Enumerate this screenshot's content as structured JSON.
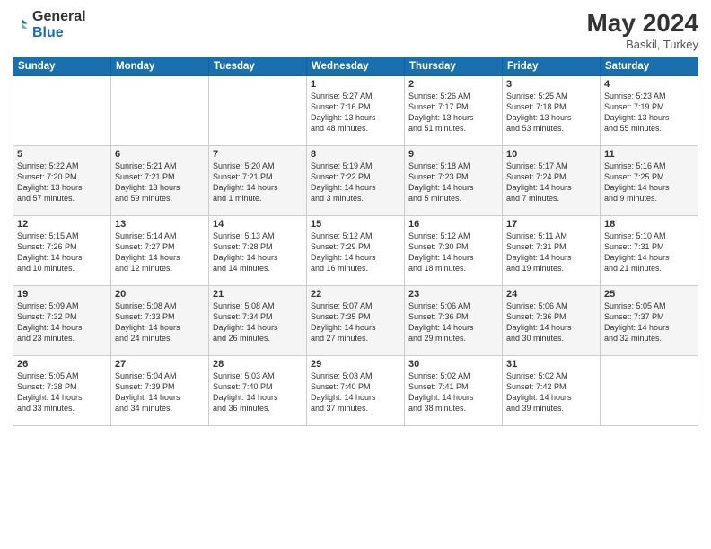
{
  "header": {
    "logo_general": "General",
    "logo_blue": "Blue",
    "month_year": "May 2024",
    "location": "Baskil, Turkey"
  },
  "weekdays": [
    "Sunday",
    "Monday",
    "Tuesday",
    "Wednesday",
    "Thursday",
    "Friday",
    "Saturday"
  ],
  "weeks": [
    {
      "alt": false,
      "days": [
        {
          "num": "",
          "info": ""
        },
        {
          "num": "",
          "info": ""
        },
        {
          "num": "",
          "info": ""
        },
        {
          "num": "1",
          "info": "Sunrise: 5:27 AM\nSunset: 7:16 PM\nDaylight: 13 hours\nand 48 minutes."
        },
        {
          "num": "2",
          "info": "Sunrise: 5:26 AM\nSunset: 7:17 PM\nDaylight: 13 hours\nand 51 minutes."
        },
        {
          "num": "3",
          "info": "Sunrise: 5:25 AM\nSunset: 7:18 PM\nDaylight: 13 hours\nand 53 minutes."
        },
        {
          "num": "4",
          "info": "Sunrise: 5:23 AM\nSunset: 7:19 PM\nDaylight: 13 hours\nand 55 minutes."
        }
      ]
    },
    {
      "alt": true,
      "days": [
        {
          "num": "5",
          "info": "Sunrise: 5:22 AM\nSunset: 7:20 PM\nDaylight: 13 hours\nand 57 minutes."
        },
        {
          "num": "6",
          "info": "Sunrise: 5:21 AM\nSunset: 7:21 PM\nDaylight: 13 hours\nand 59 minutes."
        },
        {
          "num": "7",
          "info": "Sunrise: 5:20 AM\nSunset: 7:21 PM\nDaylight: 14 hours\nand 1 minute."
        },
        {
          "num": "8",
          "info": "Sunrise: 5:19 AM\nSunset: 7:22 PM\nDaylight: 14 hours\nand 3 minutes."
        },
        {
          "num": "9",
          "info": "Sunrise: 5:18 AM\nSunset: 7:23 PM\nDaylight: 14 hours\nand 5 minutes."
        },
        {
          "num": "10",
          "info": "Sunrise: 5:17 AM\nSunset: 7:24 PM\nDaylight: 14 hours\nand 7 minutes."
        },
        {
          "num": "11",
          "info": "Sunrise: 5:16 AM\nSunset: 7:25 PM\nDaylight: 14 hours\nand 9 minutes."
        }
      ]
    },
    {
      "alt": false,
      "days": [
        {
          "num": "12",
          "info": "Sunrise: 5:15 AM\nSunset: 7:26 PM\nDaylight: 14 hours\nand 10 minutes."
        },
        {
          "num": "13",
          "info": "Sunrise: 5:14 AM\nSunset: 7:27 PM\nDaylight: 14 hours\nand 12 minutes."
        },
        {
          "num": "14",
          "info": "Sunrise: 5:13 AM\nSunset: 7:28 PM\nDaylight: 14 hours\nand 14 minutes."
        },
        {
          "num": "15",
          "info": "Sunrise: 5:12 AM\nSunset: 7:29 PM\nDaylight: 14 hours\nand 16 minutes."
        },
        {
          "num": "16",
          "info": "Sunrise: 5:12 AM\nSunset: 7:30 PM\nDaylight: 14 hours\nand 18 minutes."
        },
        {
          "num": "17",
          "info": "Sunrise: 5:11 AM\nSunset: 7:31 PM\nDaylight: 14 hours\nand 19 minutes."
        },
        {
          "num": "18",
          "info": "Sunrise: 5:10 AM\nSunset: 7:31 PM\nDaylight: 14 hours\nand 21 minutes."
        }
      ]
    },
    {
      "alt": true,
      "days": [
        {
          "num": "19",
          "info": "Sunrise: 5:09 AM\nSunset: 7:32 PM\nDaylight: 14 hours\nand 23 minutes."
        },
        {
          "num": "20",
          "info": "Sunrise: 5:08 AM\nSunset: 7:33 PM\nDaylight: 14 hours\nand 24 minutes."
        },
        {
          "num": "21",
          "info": "Sunrise: 5:08 AM\nSunset: 7:34 PM\nDaylight: 14 hours\nand 26 minutes."
        },
        {
          "num": "22",
          "info": "Sunrise: 5:07 AM\nSunset: 7:35 PM\nDaylight: 14 hours\nand 27 minutes."
        },
        {
          "num": "23",
          "info": "Sunrise: 5:06 AM\nSunset: 7:36 PM\nDaylight: 14 hours\nand 29 minutes."
        },
        {
          "num": "24",
          "info": "Sunrise: 5:06 AM\nSunset: 7:36 PM\nDaylight: 14 hours\nand 30 minutes."
        },
        {
          "num": "25",
          "info": "Sunrise: 5:05 AM\nSunset: 7:37 PM\nDaylight: 14 hours\nand 32 minutes."
        }
      ]
    },
    {
      "alt": false,
      "days": [
        {
          "num": "26",
          "info": "Sunrise: 5:05 AM\nSunset: 7:38 PM\nDaylight: 14 hours\nand 33 minutes."
        },
        {
          "num": "27",
          "info": "Sunrise: 5:04 AM\nSunset: 7:39 PM\nDaylight: 14 hours\nand 34 minutes."
        },
        {
          "num": "28",
          "info": "Sunrise: 5:03 AM\nSunset: 7:40 PM\nDaylight: 14 hours\nand 36 minutes."
        },
        {
          "num": "29",
          "info": "Sunrise: 5:03 AM\nSunset: 7:40 PM\nDaylight: 14 hours\nand 37 minutes."
        },
        {
          "num": "30",
          "info": "Sunrise: 5:02 AM\nSunset: 7:41 PM\nDaylight: 14 hours\nand 38 minutes."
        },
        {
          "num": "31",
          "info": "Sunrise: 5:02 AM\nSunset: 7:42 PM\nDaylight: 14 hours\nand 39 minutes."
        },
        {
          "num": "",
          "info": ""
        }
      ]
    }
  ]
}
